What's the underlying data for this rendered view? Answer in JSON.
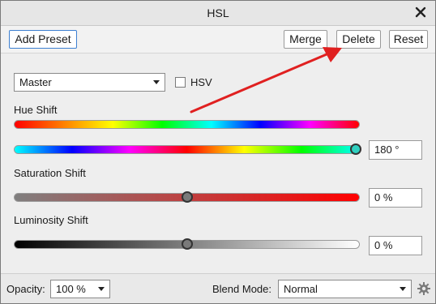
{
  "window": {
    "title": "HSL"
  },
  "toolbar": {
    "add_preset": "Add Preset",
    "merge": "Merge",
    "delete": "Delete",
    "reset": "Reset"
  },
  "channel": {
    "selected": "Master",
    "hsv_label": "HSV",
    "hsv_checked": false
  },
  "sliders": {
    "hue_label": "Hue Shift",
    "hue_value": "180 °",
    "hue_level": 1.0,
    "saturation_label": "Saturation Shift",
    "saturation_value": "0 %",
    "saturation_level": 0.5,
    "luminosity_label": "Luminosity Shift",
    "luminosity_value": "0 %",
    "luminosity_level": 0.5
  },
  "footer": {
    "opacity_label": "Opacity:",
    "opacity_value": "100 %",
    "blend_label": "Blend Mode:",
    "blend_value": "Normal"
  },
  "colors": {
    "annotation_arrow": "#e02020",
    "primary_border": "#3d7fd1"
  },
  "icons": {
    "close": "close-icon",
    "settings": "gear-icon",
    "dropdown": "chevron-down-icon"
  }
}
